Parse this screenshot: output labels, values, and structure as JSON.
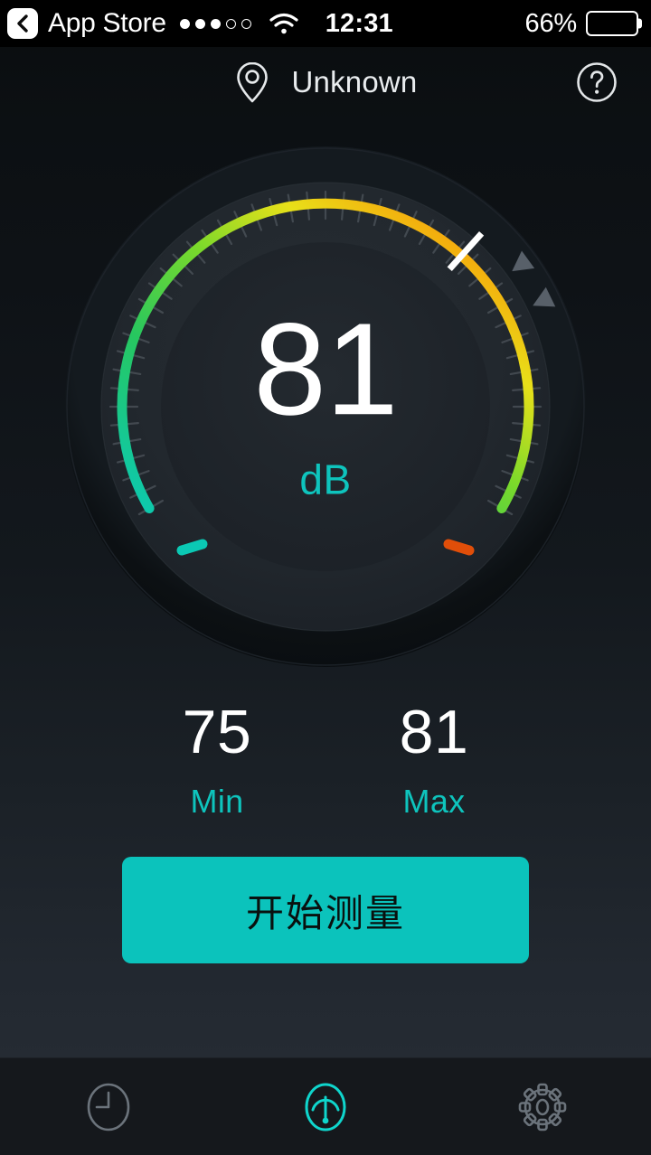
{
  "status_bar": {
    "back_label": "App Store",
    "back_icon": "chevron-left-icon",
    "signal_icon": "signal-dots-icon",
    "signal_filled": 3,
    "signal_total": 5,
    "wifi_icon": "wifi-icon",
    "time": "12:31",
    "battery_percent": "66%",
    "battery_level": 66,
    "battery_icon": "battery-icon"
  },
  "navbar": {
    "location_icon": "location-pin-icon",
    "title": "Unknown",
    "help_icon": "question-mark-circle-icon"
  },
  "gauge": {
    "value": "81",
    "unit": "dB",
    "needle_value": 81,
    "marker_one_value": 87,
    "marker_two_value": 92,
    "accent_color": "#0ec4bd",
    "needle_color": "#ffffff",
    "marker_color": "#586069",
    "tick_color": "#4a5158",
    "dial_face_color": "#22272c",
    "bezel_color": "#101316",
    "scale_min": 0,
    "scale_max": 120,
    "arc_start_angle": -120,
    "arc_end_angle": 120,
    "arc_stops": [
      {
        "offset": 0,
        "color": "#0bc9b4"
      },
      {
        "offset": 0.3,
        "color": "#27c75f"
      },
      {
        "offset": 0.5,
        "color": "#6fd72f"
      },
      {
        "offset": 0.68,
        "color": "#e8e019"
      },
      {
        "offset": 0.85,
        "color": "#f5a60c"
      },
      {
        "offset": 1,
        "color": "#e04e09"
      }
    ]
  },
  "stats": [
    {
      "name": "min",
      "value": "75",
      "label": "Min"
    },
    {
      "name": "max",
      "value": "81",
      "label": "Max"
    }
  ],
  "cta": {
    "label": "开始测量",
    "background": "#0bc3bc",
    "text_color": "#09110f"
  },
  "tabbar": {
    "active_color": "#0fd5cc",
    "inactive_color": "#6b737b",
    "items": [
      {
        "name": "history",
        "icon": "clock-icon",
        "active": false
      },
      {
        "name": "meter",
        "icon": "gauge-icon",
        "active": true
      },
      {
        "name": "settings",
        "icon": "gear-icon",
        "active": false
      }
    ]
  }
}
